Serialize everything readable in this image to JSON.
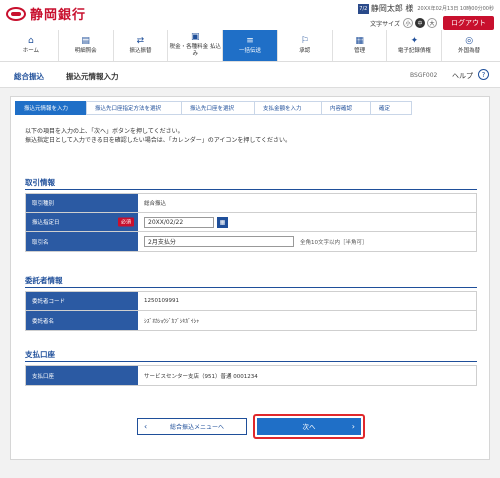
{
  "header": {
    "bank_name": "静岡銀行",
    "user_badge": "7/2",
    "user_name": "静岡太郎 様",
    "login_time": "20XX年02月13日 10時00分00秒",
    "text_size_label": "文字サイズ",
    "text_sizes": [
      "小",
      "中",
      "大"
    ],
    "logout_label": "ログアウト"
  },
  "nav": {
    "items": [
      {
        "label": "ホーム",
        "icon": "home-icon",
        "glyph": "⌂"
      },
      {
        "label": "明細照会",
        "icon": "document-search-icon",
        "glyph": "▤"
      },
      {
        "label": "振込振替",
        "icon": "transfer-icon",
        "glyph": "⇄"
      },
      {
        "label": "税金・各種料金 払込み",
        "icon": "tax-payment-icon",
        "glyph": "▣"
      },
      {
        "label": "一括伝送",
        "icon": "batch-transfer-icon",
        "glyph": "≡"
      },
      {
        "label": "承認",
        "icon": "approval-icon",
        "glyph": "⚐"
      },
      {
        "label": "管理",
        "icon": "admin-icon",
        "glyph": "▦"
      },
      {
        "label": "電子記録債権",
        "icon": "e-bond-icon",
        "glyph": "✦"
      },
      {
        "label": "外国為替",
        "icon": "forex-icon",
        "glyph": "◎"
      }
    ]
  },
  "titlebar": {
    "category": "総合振込",
    "title": "振込元情報入力",
    "screen_code": "BSGF002",
    "help_label": "ヘルプ",
    "help_icon": "?"
  },
  "steps": [
    "振込元情報を入力",
    "振込先口座指定方法を選択",
    "振込先口座を選択",
    "支払金額を入力",
    "内容確認",
    "確定"
  ],
  "intro": {
    "line1": "以下の項目を入力の上、「次へ」ボタンを押してください。",
    "line2": "振込指定日として入力できる日を確認したい場合は、「カレンダー」のアイコンを押してください。"
  },
  "transaction_info": {
    "title": "取引情報",
    "type_label": "取引種別",
    "type_value": "総合振込",
    "date_label": "振込指定日",
    "required_label": "必須",
    "date_value": "20XX/02/22",
    "name_label": "取引名",
    "name_value": "2月支払分",
    "name_hint": "全角10文字以内［半角可］"
  },
  "client_info": {
    "title": "委託者情報",
    "code_label": "委託者コード",
    "code_value": "1250109991",
    "name_label": "委託者名",
    "name_value": "ｼｽﾞｵｶｼｮｳｼﾞｶﾌﾞｼｷｶﾞｲｼｬ"
  },
  "payment_account": {
    "title": "支払口座",
    "account_label": "支払口座",
    "account_value": "サービスセンター支店（951）普通 0001234"
  },
  "buttons": {
    "back_label": "総合振込メニューへ",
    "next_label": "次へ"
  },
  "colors": {
    "brand_red": "#c8102e",
    "primary_blue": "#1f6fc7",
    "label_blue": "#2b5aa3"
  }
}
